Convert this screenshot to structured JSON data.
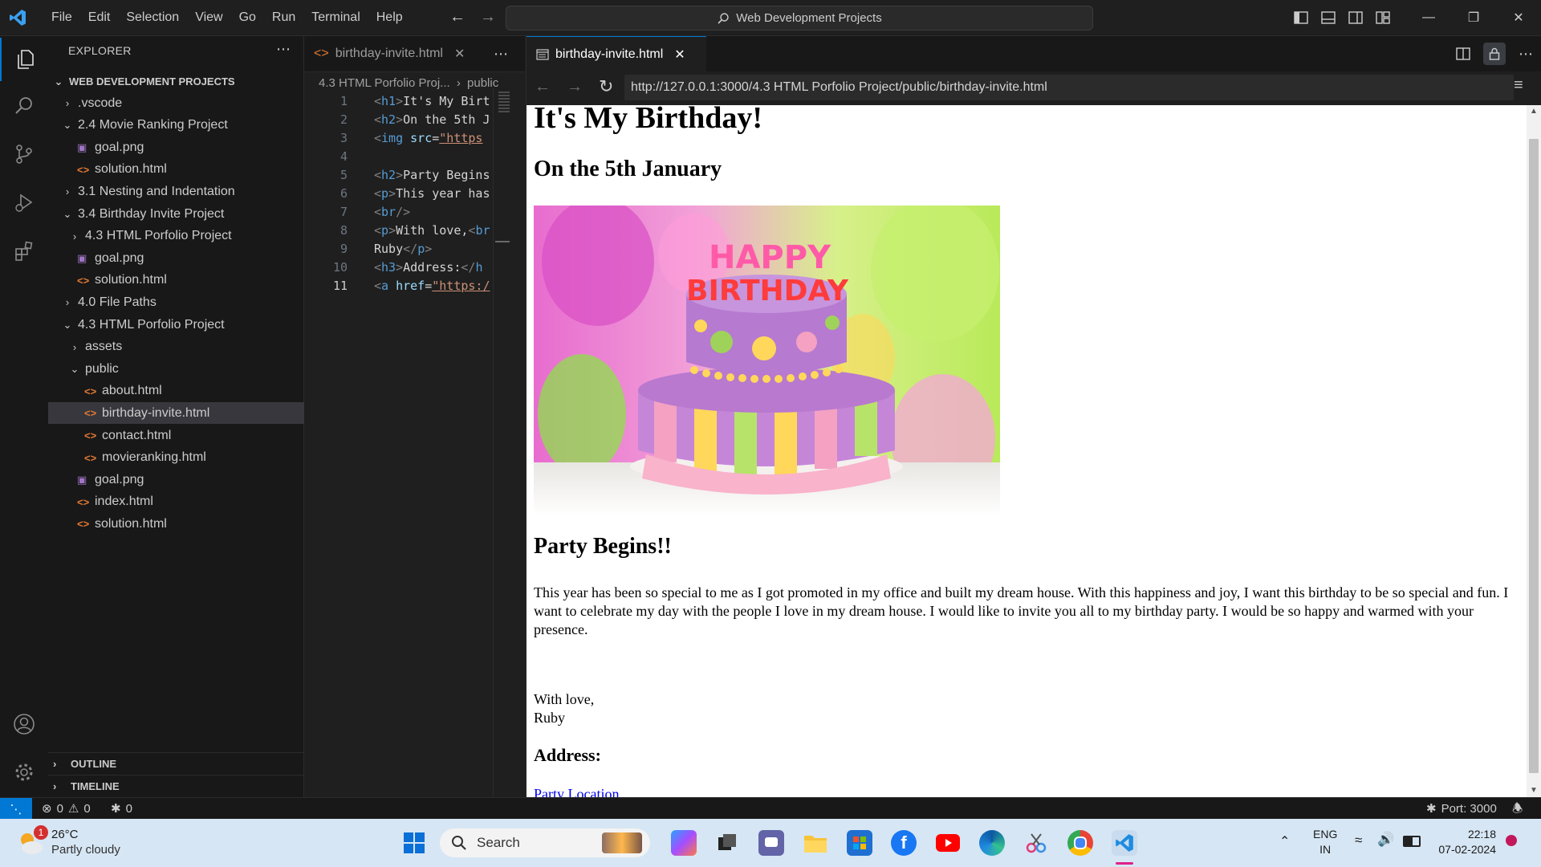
{
  "titlebar": {
    "menu": [
      "File",
      "Edit",
      "Selection",
      "View",
      "Go",
      "Run",
      "Terminal",
      "Help"
    ],
    "command_center": "Web Development Projects"
  },
  "sidebar": {
    "title": "EXPLORER",
    "workspace": "WEB DEVELOPMENT PROJECTS",
    "items": [
      {
        "label": ".vscode",
        "kind": "folder-closed",
        "depth": 1
      },
      {
        "label": "2.4 Movie Ranking Project",
        "kind": "folder-open",
        "depth": 1
      },
      {
        "label": "goal.png",
        "kind": "png",
        "depth": 2
      },
      {
        "label": "solution.html",
        "kind": "html",
        "depth": 2
      },
      {
        "label": "3.1 Nesting and Indentation",
        "kind": "folder-closed",
        "depth": 1
      },
      {
        "label": "3.4 Birthday Invite Project",
        "kind": "folder-open",
        "depth": 1
      },
      {
        "label": "4.3 HTML Porfolio Project",
        "kind": "folder-closed",
        "depth": 2
      },
      {
        "label": "goal.png",
        "kind": "png",
        "depth": 2
      },
      {
        "label": "solution.html",
        "kind": "html",
        "depth": 2
      },
      {
        "label": "4.0 File Paths",
        "kind": "folder-closed",
        "depth": 1
      },
      {
        "label": "4.3 HTML Porfolio Project",
        "kind": "folder-open",
        "depth": 1
      },
      {
        "label": "assets",
        "kind": "folder-closed",
        "depth": 2
      },
      {
        "label": "public",
        "kind": "folder-open",
        "depth": 2
      },
      {
        "label": "about.html",
        "kind": "html",
        "depth": 3
      },
      {
        "label": "birthday-invite.html",
        "kind": "html",
        "depth": 3,
        "selected": true
      },
      {
        "label": "contact.html",
        "kind": "html",
        "depth": 3
      },
      {
        "label": "movieranking.html",
        "kind": "html",
        "depth": 3
      },
      {
        "label": "goal.png",
        "kind": "png",
        "depth": 2
      },
      {
        "label": "index.html",
        "kind": "html",
        "depth": 2
      },
      {
        "label": "solution.html",
        "kind": "html",
        "depth": 2
      }
    ],
    "outline": "OUTLINE",
    "timeline": "TIMELINE"
  },
  "editor": {
    "tab": "birthday-invite.html",
    "breadcrumb": "4.3 HTML Porfolio Proj...",
    "breadcrumb2": "public",
    "current_line": "11",
    "lines": [
      {
        "n": "1",
        "parts": [
          [
            "tag",
            "<"
          ],
          [
            "name",
            "h1"
          ],
          [
            "tag",
            ">"
          ],
          [
            "text",
            "It's My Birt"
          ]
        ]
      },
      {
        "n": "2",
        "parts": [
          [
            "tag",
            "<"
          ],
          [
            "name",
            "h2"
          ],
          [
            "tag",
            ">"
          ],
          [
            "text",
            "On the 5th J"
          ]
        ]
      },
      {
        "n": "3",
        "parts": [
          [
            "tag",
            "<"
          ],
          [
            "name",
            "img"
          ],
          [
            "text",
            " "
          ],
          [
            "attr",
            "src"
          ],
          [
            "text",
            "="
          ],
          [
            "str",
            "\"https"
          ]
        ]
      },
      {
        "n": "4",
        "parts": []
      },
      {
        "n": "5",
        "parts": [
          [
            "tag",
            "<"
          ],
          [
            "name",
            "h2"
          ],
          [
            "tag",
            ">"
          ],
          [
            "text",
            "Party Begins"
          ]
        ]
      },
      {
        "n": "6",
        "parts": [
          [
            "tag",
            "<"
          ],
          [
            "name",
            "p"
          ],
          [
            "tag",
            ">"
          ],
          [
            "text",
            "This year has"
          ]
        ]
      },
      {
        "n": "7",
        "parts": [
          [
            "tag",
            "<"
          ],
          [
            "name",
            "br"
          ],
          [
            "tag",
            "/>"
          ]
        ]
      },
      {
        "n": "8",
        "parts": [
          [
            "tag",
            "<"
          ],
          [
            "name",
            "p"
          ],
          [
            "tag",
            ">"
          ],
          [
            "text",
            "With love,"
          ],
          [
            "tag",
            "<"
          ],
          [
            "name",
            "br"
          ]
        ]
      },
      {
        "n": "9",
        "parts": [
          [
            "text",
            "Ruby"
          ],
          [
            "tag",
            "</"
          ],
          [
            "name",
            "p"
          ],
          [
            "tag",
            ">"
          ]
        ]
      },
      {
        "n": "10",
        "parts": [
          [
            "tag",
            "<"
          ],
          [
            "name",
            "h3"
          ],
          [
            "tag",
            ">"
          ],
          [
            "text",
            "Address:"
          ],
          [
            "tag",
            "</"
          ],
          [
            "name",
            "h"
          ]
        ]
      },
      {
        "n": "11",
        "parts": [
          [
            "tag",
            "<"
          ],
          [
            "name",
            "a"
          ],
          [
            "text",
            " "
          ],
          [
            "attr",
            "href"
          ],
          [
            "text",
            "="
          ],
          [
            "str",
            "\"https:/"
          ]
        ]
      }
    ]
  },
  "preview": {
    "tab": "birthday-invite.html",
    "url": "http://127.0.0.1:3000/4.3 HTML Porfolio Project/public/birthday-invite.html",
    "h1": "It's My Birthday!",
    "h2_date": "On the 5th January",
    "cake_text_top": "HAPPY",
    "cake_text_bottom": "BIRTHDAY",
    "h2_party": "Party Begins!!",
    "paragraph": "This year has been so special to me as I got promoted in my office and built my dream house. With this happiness and joy, I want this birthday to be so special and fun. I want to celebrate my day with the people I love in my dream house. I would like to invite you all to my birthday party. I would be so happy and warmed with your presence.",
    "signoff_1": "With love,",
    "signoff_2": "Ruby",
    "h3_address": "Address:",
    "link": "Party Location"
  },
  "statusbar": {
    "errors": "0",
    "warnings": "0",
    "ports_count": "0",
    "port": "Port: 3000"
  },
  "taskbar": {
    "weather_temp": "26°C",
    "weather_desc": "Partly cloudy",
    "weather_badge": "1",
    "search_placeholder": "Search",
    "lang_1": "ENG",
    "lang_2": "IN",
    "time": "22:18",
    "date": "07-02-2024"
  },
  "colors": {
    "accent": "#0078d4",
    "html_icon": "#e37933",
    "png_icon": "#a074c4"
  }
}
